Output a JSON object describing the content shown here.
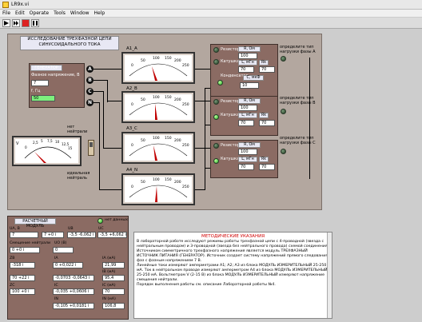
{
  "window": {
    "title": "LR9x.vi"
  },
  "menu": [
    "File",
    "Edit",
    "Operate",
    "Tools",
    "Window",
    "Help"
  ],
  "panel": {
    "title_line1": "ИССЛЕДОВАНИЕ ТРЕХФАЗНОЙ ЦЕПИ",
    "title_line2": "СИНУСОИДАЛЬНОГО ТОКА"
  },
  "generator": {
    "label": "ГЕНЕРАТОР",
    "voltage_label": "Фазное напряжение, В",
    "voltage_value": "7",
    "freq_label": "f, Гц",
    "freq_value": "50"
  },
  "terminals": [
    "A",
    "B",
    "C",
    "N"
  ],
  "switch": {
    "top_label_1": "нет",
    "top_label_2": "нейтрали",
    "bottom_label_1": "идеальная",
    "bottom_label_2": "нейтраль"
  },
  "meters": {
    "a1": {
      "label": "A1_A",
      "ticks": [
        "0",
        "50",
        "100",
        "150",
        "200",
        "250"
      ]
    },
    "a2": {
      "label": "A2_B",
      "ticks": [
        "0",
        "50",
        "100",
        "150",
        "200",
        "250"
      ]
    },
    "a3": {
      "label": "A3_C",
      "ticks": [
        "0",
        "50",
        "100",
        "150",
        "200",
        "250"
      ]
    },
    "a4": {
      "label": "A4_N",
      "ticks": [
        "0",
        "50",
        "100",
        "150",
        "200",
        "250"
      ]
    },
    "v": {
      "label": "V",
      "ticks": [
        "0",
        "2,5",
        "5",
        "7,5",
        "10",
        "12,5",
        "15"
      ]
    }
  },
  "loads": [
    {
      "resistor": "Резистор",
      "coil": "Катушка",
      "cap": "Конденсатор",
      "r_label": "R, Ом",
      "r_value": "100",
      "l_label": "L, мГн",
      "l_value": "70",
      "rk_label": "Rk",
      "rk_value": "70",
      "c_label": "C, мкФ",
      "c_value": "10",
      "ask_line1": "определите тип",
      "ask_line2": "нагрузки фазы A"
    },
    {
      "resistor": "Резистор",
      "coil": "Катушка",
      "r_label": "R, Ом",
      "r_value": "100",
      "l_label": "L, мГн",
      "l_value": "70",
      "rk_label": "Rk",
      "rk_value": "70",
      "ask_line1": "определите тип",
      "ask_line2": "нагрузки фазы B"
    },
    {
      "resistor": "Резистор",
      "coil": "Катушка",
      "r_label": "R, Ом",
      "r_value": "100",
      "l_label": "L, мГн",
      "l_value": "70",
      "rk_label": "Rk",
      "rk_value": "70",
      "ask_line1": "определите тип",
      "ask_line2": "нагрузки фазы C"
    }
  ],
  "calc": {
    "title": "РАСЧЕТНЫЙ МОДУЛЬ",
    "no_data": "нет данных",
    "ua_label": "UA, B",
    "ua_value": "7",
    "ub_value": "7 +0 i",
    "ubc_label": "UB",
    "ubc_value": "-3,5 -6,062 i",
    "uc_label": "UC",
    "uc_value": "-3,5 +6,062 i",
    "offset_label": "Смещение нейтрали",
    "offset_value": "0 +0 i",
    "uo_label": "UO (B)",
    "uo_value": "0",
    "za_label": "ZA",
    "za_value": "0",
    "zb_label": "ZB",
    "zb_value": "-318 i",
    "ia_label": "IA",
    "ia_value": "0 +0,022 i",
    "ia_mod_label": "IA (мА)",
    "ia_mod_value": "21,99",
    "zb2_value": "70 +22 i",
    "ib_value": "-0,0703 -0,0643 i",
    "ib_mod_label": "IB (мА)",
    "ib_mod_value": "95,4",
    "zc_label": "ZC",
    "zc_value": "100 +0 i",
    "ic_label": "IC",
    "ic_value": "-0,035 +0,0606 i",
    "ic_mod_label": "IC (мА)",
    "ic_mod_value": "70",
    "in_label": "IN",
    "in_value": "-0,105 +0,0181 i",
    "in_mod_label": "IN (мА)",
    "in_mod_value": "106,8"
  },
  "notes": {
    "title": "МЕТОДИЧЕСКИЕ УКАЗАНИЯ",
    "p1": "В лабораторной работе исследуют режимы работы трехфазной цепи с 4-проводной (звезда с нейтральным проводом) и 3-проводной (звезда без нейтрального провода) схемой соединения. Источником симметричного трехфазного напряжения является модуль ТРЕХФАЗНЫЙ ИСТОЧНИК ПИТАНИЯ (ГЕНЕРАТОР). Источник создает систему напряжений прямого следования фаз с фазным напряжением 7 В.",
    "p2": "Линейные токи измеряют амперметрами А1; А2; А3 из блока МОДУЛЬ ИЗМЕРИТЕЛЬНЫЙ 25-250 мА. Ток в нейтральном проводе измеряют амперметром А4 из блока МОДУЛЬ ИЗМЕРИТЕЛЬНЫЙ 25-250 мА. Вольтметром V (2-15 В) из блока МОДУЛЬ ИЗМЕРИТЕЛЬНЫЙ измеряют напряжение смещения нейтрали.",
    "p3": "Порядок выполнения работы см. описание Лабораторной работы №4."
  }
}
